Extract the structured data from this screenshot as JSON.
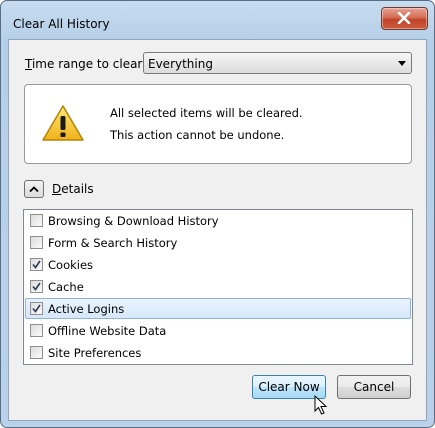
{
  "window": {
    "title": "Clear All History",
    "close_icon": "close-icon"
  },
  "time_range": {
    "label_accel": "T",
    "label_rest": "ime range to clear:",
    "selected": "Everything"
  },
  "warning": {
    "icon": "warning-icon",
    "line1": "All selected items will be cleared.",
    "line2": "This action cannot be undone."
  },
  "details": {
    "label_accel": "D",
    "label_rest": "etails",
    "expanded": true
  },
  "items": [
    {
      "label": "Browsing & Download History",
      "checked": false,
      "selected": false
    },
    {
      "label": "Form & Search History",
      "checked": false,
      "selected": false
    },
    {
      "label": "Cookies",
      "checked": true,
      "selected": false
    },
    {
      "label": "Cache",
      "checked": true,
      "selected": false
    },
    {
      "label": "Active Logins",
      "checked": true,
      "selected": true
    },
    {
      "label": "Offline Website Data",
      "checked": false,
      "selected": false
    },
    {
      "label": "Site Preferences",
      "checked": false,
      "selected": false
    }
  ],
  "buttons": {
    "clear_now": "Clear Now",
    "cancel": "Cancel"
  }
}
